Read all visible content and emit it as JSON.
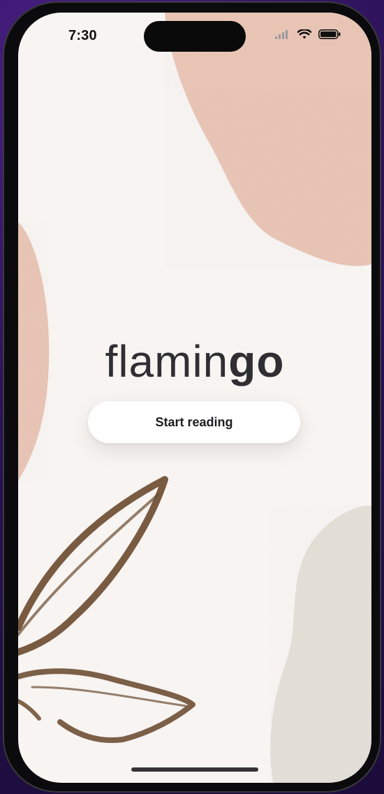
{
  "status_bar": {
    "time": "7:30",
    "icons": [
      "signal-icon",
      "wifi-icon",
      "battery-icon"
    ]
  },
  "app": {
    "logo_part1": "flamin",
    "logo_part2": "go",
    "start_button_label": "Start reading"
  },
  "colors": {
    "background": "#f8f4f2",
    "pink_shape": "#e9c3b3",
    "beige_shape": "#e3dfd7",
    "leaf_stroke": "#6a4a2f",
    "text": "#2f2f33",
    "button_bg": "#ffffff"
  }
}
